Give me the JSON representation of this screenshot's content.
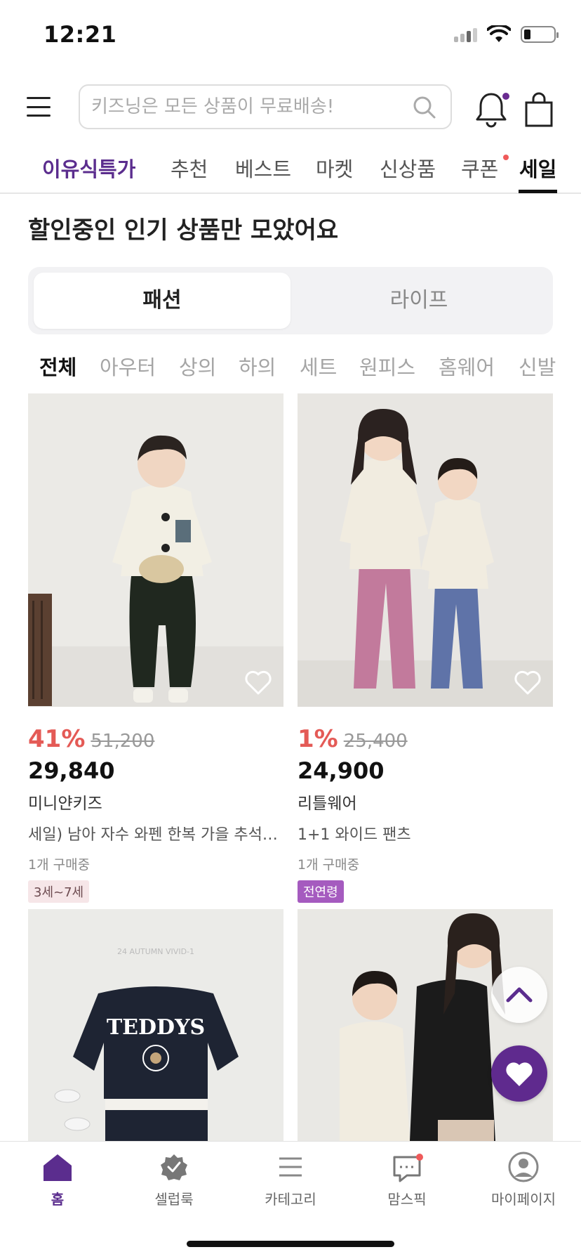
{
  "status_bar": {
    "time": "12:21"
  },
  "header": {
    "search_placeholder": "키즈닝은 모든 상품이 무료배송!",
    "icons": [
      "menu-icon",
      "search-icon",
      "bell-icon",
      "shopping-bag-icon"
    ]
  },
  "main_tabs": [
    {
      "label": "이유식특가"
    },
    {
      "label": "추천"
    },
    {
      "label": "베스트"
    },
    {
      "label": "마켓"
    },
    {
      "label": "신상품"
    },
    {
      "label": "쿠폰"
    },
    {
      "label": "세일"
    }
  ],
  "section_title": "할인중인 인기 상품만 모았어요",
  "segment": {
    "options": [
      "패션",
      "라이프"
    ],
    "selected": "패션"
  },
  "category_chips": [
    "전체",
    "아우터",
    "상의",
    "하의",
    "세트",
    "원피스",
    "홈웨어",
    "신발"
  ],
  "products": [
    {
      "discount": "41%",
      "original_price": "51,200",
      "price": "29,840",
      "brand": "미니얀키즈",
      "name": "세일) 남아 자수 와펜 한복 가을 추석 (...",
      "sold": "1개 구매중",
      "badge": "3세~7세"
    },
    {
      "discount": "1%",
      "original_price": "25,400",
      "price": "24,900",
      "brand": "리틀웨어",
      "name": " 1+1 와이드 팬츠",
      "sold": "1개 구매중",
      "badge": "전연령"
    },
    {
      "image_text": "24 AUTUMN VIVID-1",
      "print_text": "TEDDYS"
    },
    {}
  ],
  "bottom_nav": [
    {
      "label": "홈",
      "icon": "home-icon"
    },
    {
      "label": "셀럽룩",
      "icon": "badge-check-icon"
    },
    {
      "label": "카테고리",
      "icon": "list-icon"
    },
    {
      "label": "맘스픽",
      "icon": "chat-icon"
    },
    {
      "label": "마이페이지",
      "icon": "user-icon"
    }
  ],
  "colors": {
    "brand": "#5b2d8e",
    "discount": "#e45a56",
    "badge_all": "#a55bbf",
    "badge_age": "#f6e6e8"
  }
}
